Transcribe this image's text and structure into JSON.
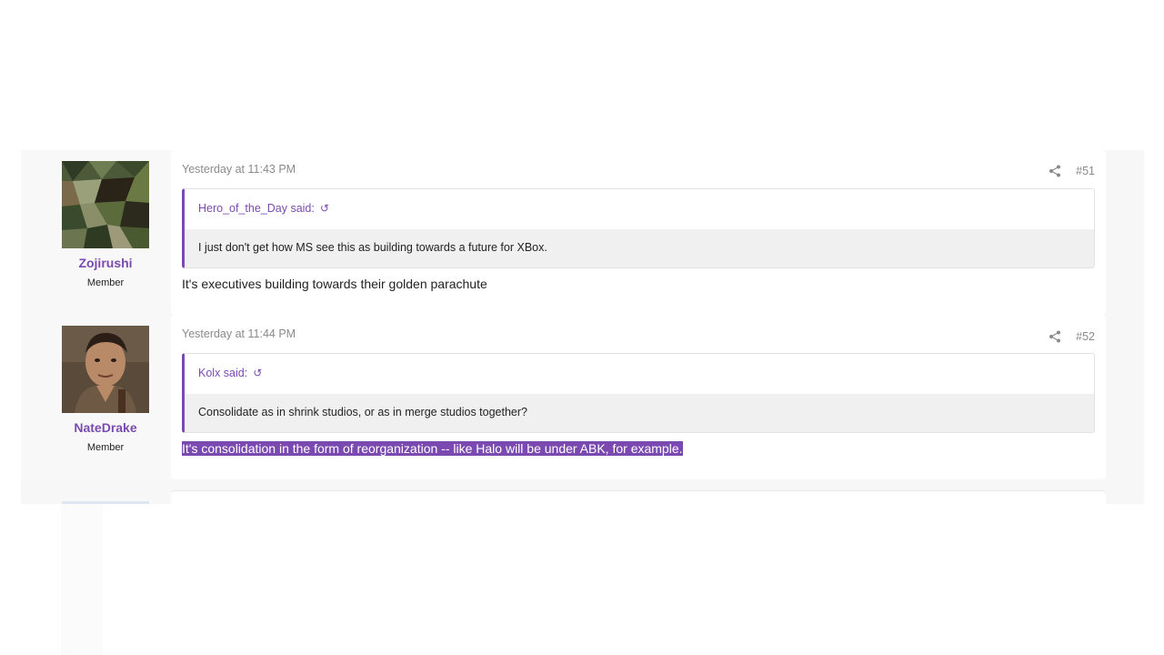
{
  "posts": [
    {
      "author": "Zojirushi",
      "role": "Member",
      "timestamp": "Yesterday at 11:43 PM",
      "number": "#51",
      "quote_author": "Hero_of_the_Day said:",
      "quote_text": "I just don't get how MS see this as building towards a future for XBox.",
      "reply": "It's executives building towards their golden parachute"
    },
    {
      "author": "NateDrake",
      "role": "Member",
      "timestamp": "Yesterday at 11:44 PM",
      "number": "#52",
      "quote_author": "Kolx said:",
      "quote_text": "Consolidate as in shrink studios, or as in merge studios together?",
      "reply": "It's consolidation in the form of reorganization -- like Halo will be under ABK, for example."
    }
  ],
  "icons": {
    "share": "share-icon",
    "quote_arrow": "arrow-up-icon"
  },
  "colors": {
    "accent": "#7a4ab0",
    "selection": "#7a4ab0"
  }
}
